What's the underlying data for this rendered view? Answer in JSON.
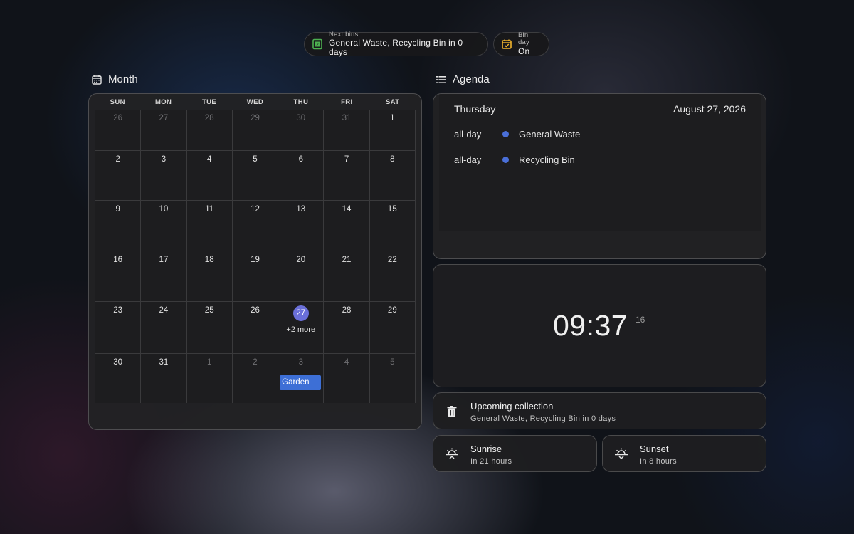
{
  "chips": [
    {
      "label": "Next bins",
      "value": "General Waste, Recycling Bin in 0 days",
      "icon": "bin-calendar-icon",
      "icon_color": "#4caf50"
    },
    {
      "label": "Bin day",
      "value": "On",
      "icon": "calendar-check-icon",
      "icon_color": "#f2b52d"
    }
  ],
  "month": {
    "title": "Month",
    "weekdays": [
      "SUN",
      "MON",
      "TUE",
      "WED",
      "THU",
      "FRI",
      "SAT"
    ],
    "weeks": [
      [
        "26",
        "27",
        "28",
        "29",
        "30",
        "31",
        "1"
      ],
      [
        "2",
        "3",
        "4",
        "5",
        "6",
        "7",
        "8"
      ],
      [
        "9",
        "10",
        "11",
        "12",
        "13",
        "14",
        "15"
      ],
      [
        "16",
        "17",
        "18",
        "19",
        "20",
        "21",
        "22"
      ],
      [
        "23",
        "24",
        "25",
        "26",
        "27",
        "28",
        "29"
      ],
      [
        "30",
        "31",
        "1",
        "2",
        "3",
        "4",
        "5"
      ]
    ],
    "today": "27",
    "today_more": "+2 more",
    "event_label": "Garden",
    "accent": "#6a6fd8",
    "event_color": "#3d6fd6"
  },
  "agenda": {
    "title": "Agenda",
    "day": "Thursday",
    "date": "August 27, 2026",
    "items": [
      {
        "time": "all-day",
        "title": "General Waste",
        "color": "#4a6fd8"
      },
      {
        "time": "all-day",
        "title": "Recycling Bin",
        "color": "#4a6fd8"
      }
    ]
  },
  "clock": {
    "time": "09:37",
    "seconds": "16"
  },
  "upcoming": {
    "title": "Upcoming collection",
    "subtitle": "General Waste, Recycling Bin in 0 days",
    "icon": "trash-icon"
  },
  "sunrise": {
    "title": "Sunrise",
    "subtitle": "In 21 hours",
    "icon": "sunrise-icon"
  },
  "sunset": {
    "title": "Sunset",
    "subtitle": "In 8 hours",
    "icon": "sunset-icon"
  }
}
